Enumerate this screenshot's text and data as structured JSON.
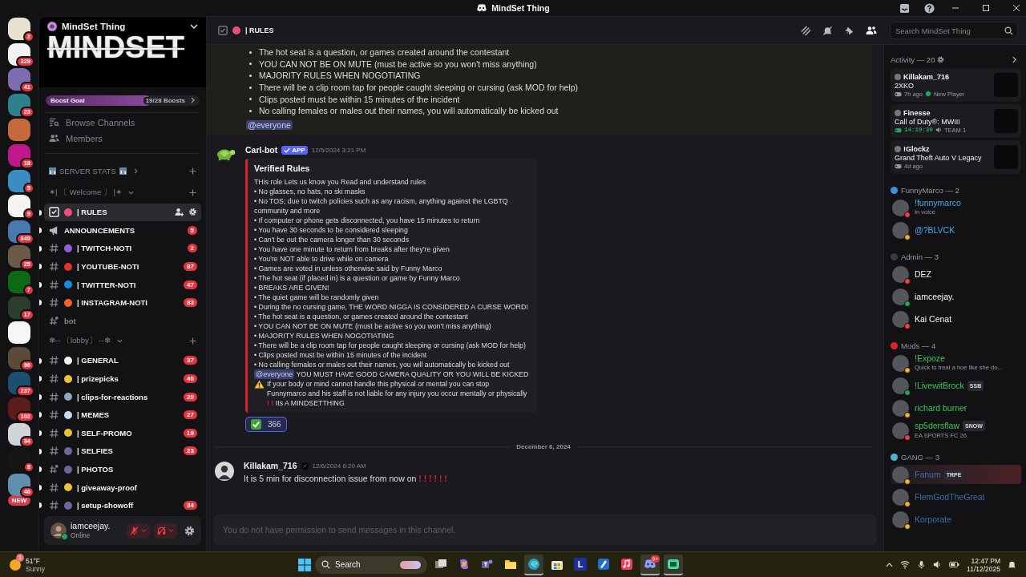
{
  "window": {
    "title": "MindSet Thing"
  },
  "servers": [
    {
      "badge": "2",
      "color": "#e8e0d0"
    },
    {
      "badge": "329",
      "color": "#f2f2f2"
    },
    {
      "badge": "41",
      "color": "#7d6db0"
    },
    {
      "badge": "23",
      "color": "#2f7f8c"
    },
    {
      "color": "#c46a3c"
    },
    {
      "badge": "18",
      "color": "#c0188a"
    },
    {
      "badge": "5",
      "color": "#3b8cc4"
    },
    {
      "badge": "9",
      "color": "#f4f4f4"
    },
    {
      "badge": "849",
      "color": "#4a78b0"
    },
    {
      "badge": "25",
      "color": "#6b5a48"
    },
    {
      "badge": "7",
      "color": "#0e6a12"
    },
    {
      "badge": "17",
      "color": "#2d3d2d"
    },
    {
      "color": "#f5f7f7"
    },
    {
      "badge": "96",
      "color": "#5b4a38"
    },
    {
      "badge": "237",
      "color": "#1b4f6f"
    },
    {
      "badge": "102",
      "color": "#5c1c1c"
    },
    {
      "badge": "94",
      "color": "#d0d4d8"
    },
    {
      "badge": "8",
      "color": "#161616"
    },
    {
      "badge": "46",
      "color": "#5f8fae"
    }
  ],
  "new_label": "NEW",
  "guild": {
    "name": "MindSet Thing",
    "banner": "MINDSET",
    "boost": {
      "label": "Boost Goal",
      "progress": "19/28 Boosts",
      "level": 0.68
    }
  },
  "nav": [
    {
      "kind": "browse",
      "label": "Browse Channels"
    },
    {
      "kind": "members",
      "label": "Members"
    }
  ],
  "channel_list": [
    {
      "kind": "category",
      "name": "SERVER STATS",
      "expanded": false
    },
    {
      "kind": "category",
      "name": "✶| 〔 Welcome 〕 |✶",
      "expanded": true
    },
    {
      "kind": "rules",
      "name": "| RULES",
      "color": "#e8517e",
      "selected": true,
      "unread": true
    },
    {
      "kind": "announcement",
      "name": "ANNOUNCEMENTS",
      "badge": "5",
      "selected": false,
      "unread": true
    },
    {
      "kind": "text",
      "name": "| TWITCH-NOTI",
      "color": "#8e5fd6",
      "badge": "2",
      "selected": false,
      "unread": true
    },
    {
      "kind": "text",
      "name": "| YOUTUBE-NOTI",
      "color": "#e0342c",
      "badge": "87",
      "selected": false,
      "unread": true
    },
    {
      "kind": "text",
      "name": "| TWITTER-NOTI",
      "color": "#1d8ce0",
      "badge": "47",
      "selected": false,
      "unread": true
    },
    {
      "kind": "text",
      "name": "| INSTAGRAM-NOTI",
      "color": "#f4642a",
      "badge": "83",
      "selected": false,
      "unread": true
    },
    {
      "kind": "thread",
      "name": "bot",
      "selected": false,
      "unread": false
    },
    {
      "kind": "category",
      "name": "❄-- 〔lobby〕 --❄",
      "expanded": true
    },
    {
      "kind": "text",
      "name": "| GENERAL",
      "color": "#f2f2f2",
      "badge": "37",
      "selected": false,
      "unread": true
    },
    {
      "kind": "text",
      "name": "| prizepicks",
      "color": "#e8c33a",
      "badge": "40",
      "selected": false,
      "unread": true
    },
    {
      "kind": "text",
      "name": "| clips-for-reactions",
      "color": "#8fa8c0",
      "badge": "20",
      "selected": false,
      "unread": true
    },
    {
      "kind": "text",
      "name": "| MEMES",
      "color": "#c8d8e8",
      "badge": "27",
      "selected": false,
      "unread": true
    },
    {
      "kind": "text",
      "name": "| SELF-PROMO",
      "color": "#e8c33a",
      "badge": "19",
      "selected": false,
      "unread": true
    },
    {
      "kind": "text",
      "name": "| SELFIES",
      "color": "#6a6a9a",
      "badge": "23",
      "selected": false,
      "unread": true
    },
    {
      "kind": "thread",
      "name": "| PHOTOS",
      "color": "#6a6a9a",
      "selected": false,
      "unread": true
    },
    {
      "kind": "text",
      "name": "| giveaway-proof",
      "color": "#e8c33a",
      "selected": false,
      "unread": true
    },
    {
      "kind": "text",
      "name": "| setup-showoff",
      "color": "#6a6a9a",
      "badge": "34",
      "selected": false,
      "unread": true
    }
  ],
  "user_panel": {
    "name": "iamceejay.",
    "status_text": "Online",
    "color": "#23a55a",
    "muted": true,
    "deafened": true
  },
  "header": {
    "channel": "| RULES",
    "search": {
      "placeholder": "Search MindSet Thing"
    }
  },
  "messages": [
    {
      "kind": "continuation",
      "bullets": [
        "The hot seat is a question, or games created around the contestant",
        "YOU CAN NOT BE ON MUTE (must be active so you won't miss anything)",
        "MAJORITY RULES WHEN NOGOTIATING",
        "There will be a clip room tap for people caught sleeping or cursing (ask MOD for help)",
        "Clips posted must be within 15 minutes of the incident",
        "No calling females or males out their names, you will automatically be kicked out"
      ],
      "mention": "@everyone"
    },
    {
      "kind": "bot",
      "author": "Carl-bot",
      "tag": "APP",
      "time": "12/5/2024 3:21 PM",
      "embed": {
        "title": "Verified Rules",
        "lines": [
          "THis role Lets us know you Read and understand rules",
          "• No glasses, no hats, no ski masks",
          "• No TOS; due to twitch policies such as any racism, anything against the LGBTQ community and more",
          "• If computer or phone gets disconnected, you have 15 minutes to return",
          "• You have 30 seconds to be considered sleeping",
          "• Can't be out the camera longer than 30 seconds",
          "• You have one minute to return from breaks after they're given",
          "• You're NOT able to drive while on camera",
          "• Games are voted in unless otherwise said by Funny Marco",
          "• The hot seat (if placed in) is a question or game by Funny Marco",
          "• BREAKS ARE GIVEN!",
          "• The quiet game will be randomly given",
          "• During the no cursing game, THE WORD NIGGA IS CONSIDERED A CURSE WORD!",
          "• The hot seat is a question, or games created around the contestant",
          "• YOU CAN NOT BE ON MUTE (must be active so you won't miss anything)",
          "• MAJORITY RULES WHEN NOGOTIATING",
          "• There will be a clip room tap for people caught sleeping or cursing (ask MOD for help)",
          "• Clips posted must be within 15 minutes of the incident",
          "• No calling females or males out their names, you will automatically be kicked out"
        ],
        "mention": "@everyone",
        "mention_text": "YOU MUST HAVE GOOD CAMERA QUALITY OR YOU WILL BE KICKED",
        "warning": "If your body or mind cannot handle this physical or mental you can stop Funnymarco and his staff is not liable for any injury you occur mentally or physically",
        "marks": "! !",
        "closing": "Its A MINDSETTHING"
      },
      "reaction": {
        "count": "366",
        "selected": true
      }
    },
    {
      "kind": "divider",
      "label": "December 6, 2024"
    },
    {
      "kind": "user",
      "author": "Killakam_716",
      "time": "12/6/2024 6:20 AM",
      "text": "It is 5 min for disconnection issue from now on",
      "marks": "! ! ! ! ! !"
    }
  ],
  "composer": {
    "placeholder": "You do not have permission to send messages in this channel."
  },
  "activity": {
    "title": "Activity — 20",
    "cards": [
      {
        "user": "Killakam_716",
        "game": "2XKO",
        "ago": "7h ago",
        "note": "New Player"
      },
      {
        "user": "Finesse",
        "game": "Call of Duty®: MWIII",
        "elapsed": "14:19:30",
        "note": "TEAM 1"
      },
      {
        "user": "!Glockz",
        "game": "Grand Theft Auto V Legacy",
        "ago": "4d ago"
      }
    ]
  },
  "groups": [
    {
      "name": "FunnyMarco — 2",
      "color": "#3d8fe8",
      "members": [
        {
          "name": "!funnymarco",
          "color": "#f23f43",
          "sub": "In voice",
          "highlighted": false
        },
        {
          "name": "@?BLVCK",
          "color": "#f0b232",
          "highlighted": false
        }
      ]
    },
    {
      "name": "Admin — 3",
      "color": "#3a3a42",
      "members": [
        {
          "name": "DEZ",
          "color": "#f23f43",
          "highlighted": false
        },
        {
          "name": "iamceejay.",
          "color": "#23a55a",
          "highlighted": false
        },
        {
          "name": "Kai Cenat",
          "color": "#f23f43",
          "highlighted": false
        }
      ]
    },
    {
      "name": "Mods — 4",
      "color": "#e0202e",
      "members": [
        {
          "name": "!Expoze",
          "color": "#f0b232",
          "sub": "Quick to treat a hoe like she do...",
          "highlighted": false
        },
        {
          "name": "!LivewitBrock",
          "color": "#23a55a",
          "tag": "SSB",
          "highlighted": false
        },
        {
          "name": "richard burner",
          "color": "#f0b232",
          "highlighted": false
        },
        {
          "name": "sp5dersflaw",
          "color": "#f23f43",
          "tag": "SNOW",
          "sub": "EA SPORTS FC 26",
          "highlighted": false
        }
      ]
    },
    {
      "name": "GANG — 3",
      "color": "#4ab8c8",
      "members": [
        {
          "name": "Fanum",
          "color": "#f0b232",
          "tag": "TRPE",
          "highlighted": true
        },
        {
          "name": "FlemGodTheGreat",
          "color": "#f0b232",
          "highlighted": false
        },
        {
          "name": "Korporate",
          "color": "#f0b232",
          "highlighted": false
        }
      ]
    }
  ],
  "taskbar": {
    "weather": {
      "temp": "51°F",
      "condition": "Sunny",
      "badge": "1"
    },
    "search": "Search",
    "apps": [
      {
        "kind": "taskview",
        "running": false
      },
      {
        "kind": "copilot",
        "running": false
      },
      {
        "kind": "teams",
        "running": false
      },
      {
        "kind": "folder",
        "running": false
      },
      {
        "kind": "edge",
        "running": true
      },
      {
        "kind": "store",
        "running": false
      },
      {
        "kind": "letter",
        "label": "L",
        "running": false
      },
      {
        "kind": "pen",
        "running": false
      },
      {
        "kind": "music",
        "running": false
      },
      {
        "kind": "discord",
        "badge": "9+",
        "running": true
      },
      {
        "kind": "chat",
        "running": true
      }
    ],
    "time": "12:47 PM",
    "date": "11/12/2025"
  }
}
